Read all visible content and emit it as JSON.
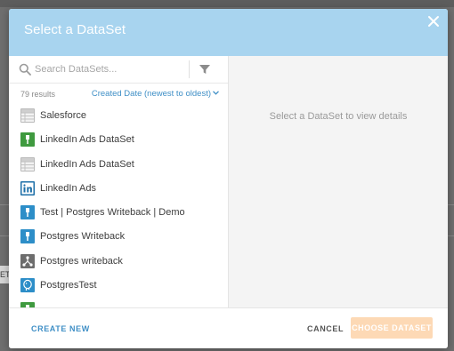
{
  "modal": {
    "title": "Select a DataSet",
    "detail_hint": "Select a DataSet to view details"
  },
  "search": {
    "placeholder": "Search DataSets...",
    "value": ""
  },
  "results": {
    "count": "79 results",
    "sort_label": "Created Date (newest to oldest)"
  },
  "datasets": [
    {
      "label": "Salesforce",
      "icon": "table-icon",
      "color": "#cfcfcf"
    },
    {
      "label": "LinkedIn Ads DataSet",
      "icon": "connector-icon",
      "color": "#3f9a3f"
    },
    {
      "label": "LinkedIn Ads DataSet",
      "icon": "table-icon",
      "color": "#cfcfcf"
    },
    {
      "label": "LinkedIn Ads",
      "icon": "linkedin-icon",
      "color": "#1d6fa8"
    },
    {
      "label": "Test | Postgres Writeback | Demo",
      "icon": "connector-icon",
      "color": "#2d8ec8"
    },
    {
      "label": "Postgres Writeback",
      "icon": "connector-icon",
      "color": "#2d8ec8"
    },
    {
      "label": "Postgres writeback",
      "icon": "dataflow-icon",
      "color": "#6d6d6d"
    },
    {
      "label": "PostgresTest",
      "icon": "postgres-icon",
      "color": "#2d8ec8"
    },
    {
      "label": "",
      "icon": "connector-icon",
      "color": "#3f9a3f"
    }
  ],
  "footer": {
    "create_new": "CREATE NEW",
    "cancel": "CANCEL",
    "choose": "CHOOSE DATASET"
  },
  "colors": {
    "header_bg": "#a8d4ef",
    "accent_blue": "#3f8fc6",
    "choose_btn_disabled": "#fdd9b5"
  }
}
